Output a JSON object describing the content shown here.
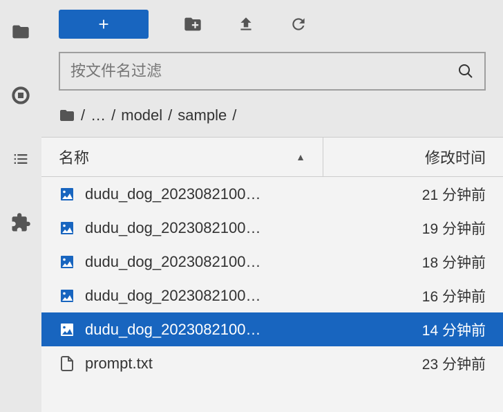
{
  "sidebar": {
    "items": [
      {
        "name": "folder"
      },
      {
        "name": "stop"
      },
      {
        "name": "list"
      },
      {
        "name": "extension"
      }
    ]
  },
  "toolbar": {
    "add_label": "+"
  },
  "search": {
    "placeholder": "按文件名过滤"
  },
  "breadcrumb": {
    "ellipsis": "…",
    "segments": [
      "model",
      "sample"
    ]
  },
  "table": {
    "columns": {
      "name": "名称",
      "modified": "修改时间"
    },
    "sort": {
      "column": "name",
      "dir": "asc"
    },
    "rows": [
      {
        "type": "image",
        "name": "dudu_dog_2023082100…",
        "modified": "21 分钟前",
        "selected": false
      },
      {
        "type": "image",
        "name": "dudu_dog_2023082100…",
        "modified": "19 分钟前",
        "selected": false
      },
      {
        "type": "image",
        "name": "dudu_dog_2023082100…",
        "modified": "18 分钟前",
        "selected": false
      },
      {
        "type": "image",
        "name": "dudu_dog_2023082100…",
        "modified": "16 分钟前",
        "selected": false
      },
      {
        "type": "image",
        "name": "dudu_dog_2023082100…",
        "modified": "14 分钟前",
        "selected": true
      },
      {
        "type": "file",
        "name": "prompt.txt",
        "modified": "23 分钟前",
        "selected": false
      }
    ]
  }
}
